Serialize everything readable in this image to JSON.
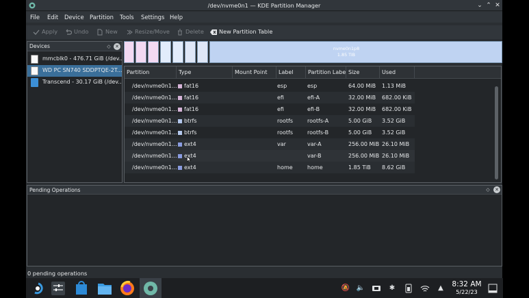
{
  "window": {
    "title": "/dev/nvme0n1 — KDE Partition Manager"
  },
  "menu": [
    "File",
    "Edit",
    "Device",
    "Partition",
    "Tools",
    "Settings",
    "Help"
  ],
  "toolbar": {
    "apply": "Apply",
    "undo": "Undo",
    "new": "New",
    "resize": "Resize/Move",
    "delete": "Delete",
    "new_table": "New Partition Table"
  },
  "devices": {
    "header": "Devices",
    "items": [
      {
        "label": "mmcblk0 - 476.71 GiB (/dev..."
      },
      {
        "label": "WD PC SN740 SDDPTQE-2T..."
      },
      {
        "label": "Transcend - 30.17 GiB (/dev..."
      }
    ]
  },
  "partition_map": {
    "name": "nvme0n1p8",
    "size": "1.85 TiB"
  },
  "table": {
    "headers": [
      "Partition",
      "Type",
      "Mount Point",
      "Label",
      "Partition Labe",
      "Size",
      "Used"
    ],
    "rows": [
      {
        "partition": "/dev/nvme0n1...",
        "type": "fat16",
        "mount": "",
        "label": "esp",
        "plabel": "esp",
        "size": "64.00 MiB",
        "used": "1.13 MiB"
      },
      {
        "partition": "/dev/nvme0n1...",
        "type": "fat16",
        "mount": "",
        "label": "efi",
        "plabel": "efi-A",
        "size": "32.00 MiB",
        "used": "682.00 KiB"
      },
      {
        "partition": "/dev/nvme0n1...",
        "type": "fat16",
        "mount": "",
        "label": "efi",
        "plabel": "efi-B",
        "size": "32.00 MiB",
        "used": "682.00 KiB"
      },
      {
        "partition": "/dev/nvme0n1...",
        "type": "btrfs",
        "mount": "",
        "label": "rootfs",
        "plabel": "rootfs-A",
        "size": "5.00 GiB",
        "used": "3.52 GiB"
      },
      {
        "partition": "/dev/nvme0n1...",
        "type": "btrfs",
        "mount": "",
        "label": "rootfs",
        "plabel": "rootfs-B",
        "size": "5.00 GiB",
        "used": "3.52 GiB"
      },
      {
        "partition": "/dev/nvme0n1...",
        "type": "ext4",
        "mount": "",
        "label": "var",
        "plabel": "var-A",
        "size": "256.00 MiB",
        "used": "26.10 MiB"
      },
      {
        "partition": "/dev/nvme0n1...",
        "type": "ext4",
        "mount": "",
        "label": "",
        "plabel": "var-B",
        "size": "256.00 MiB",
        "used": "26.10 MiB"
      },
      {
        "partition": "/dev/nvme0n1...",
        "type": "ext4",
        "mount": "",
        "label": "home",
        "plabel": "home",
        "size": "1.85 TiB",
        "used": "8.62 GiB"
      }
    ]
  },
  "type_colors": {
    "fat16": "#d6b4d8",
    "btrfs": "#b3c7ec",
    "ext4": "#8a9ce0"
  },
  "pending": {
    "header": "Pending Operations"
  },
  "status": "0 pending operations",
  "clock": {
    "time": "8:32 AM",
    "date": "5/22/23"
  }
}
